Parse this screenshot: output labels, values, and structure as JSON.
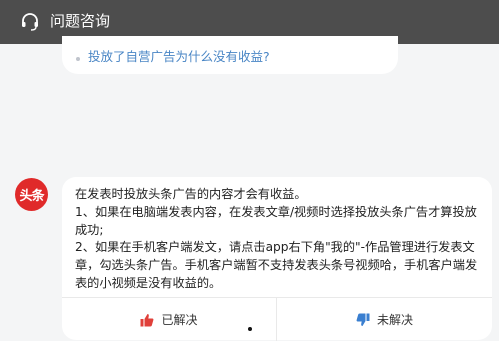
{
  "header": {
    "title": "问题咨询",
    "icon": "headset-icon",
    "background": "#4d4d4d"
  },
  "question": {
    "text": "投放了自营广告为什么没有收益?",
    "color": "#4a86c5"
  },
  "bot": {
    "avatar_text": "头条",
    "avatar_color": "#e02a2a"
  },
  "answer": {
    "lines": [
      "在发表时投放头条广告的内容才会有收益。",
      "1、如果在电脑端发表内容，在发表文章/视频时选择投放头条广告才算投放成功;",
      "2、如果在手机客户端发文，请点击app右下角\"我的\"-作品管理进行发表文章，勾选头条广告。手机客户端暂不支持发表头条号视频哈，手机客户端发表的小视频是没有收益的。"
    ]
  },
  "feedback": {
    "solved_label": "已解决",
    "unsolved_label": "未解决",
    "solved_icon": "thumbs-up-icon",
    "unsolved_icon": "thumbs-down-icon",
    "solved_color": "#e0403a",
    "unsolved_color": "#3a7fd0"
  }
}
